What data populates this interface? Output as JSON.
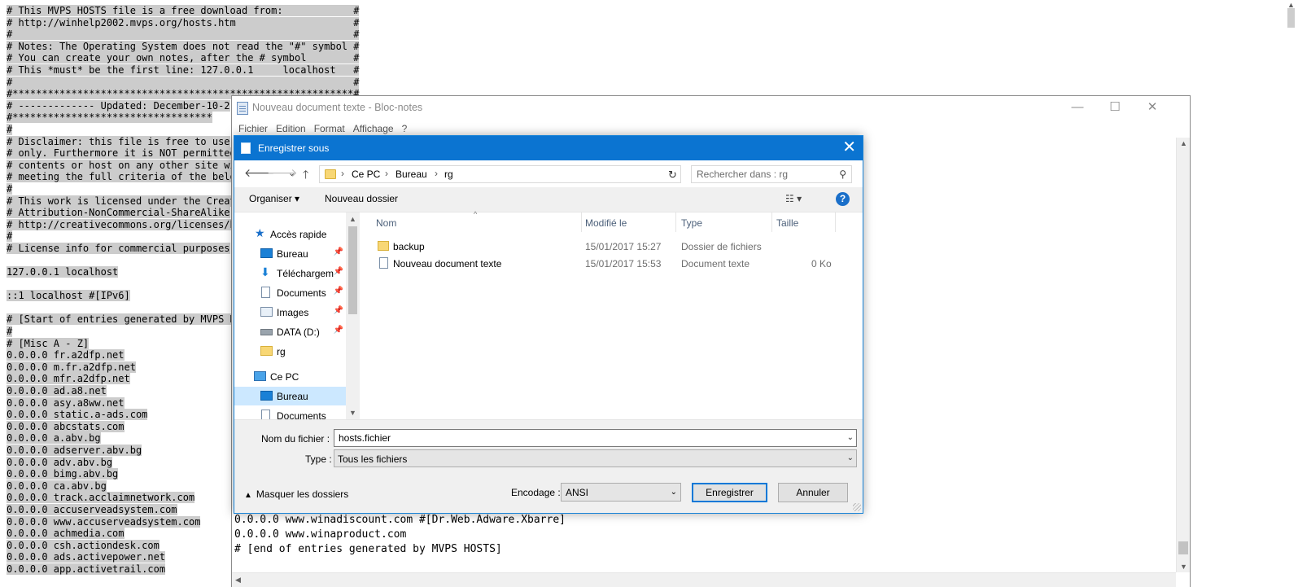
{
  "background_text": {
    "lines": [
      "# This MVPS HOSTS file is a free download from:            #",
      "# http://winhelp2002.mvps.org/hosts.htm                    #",
      "#                                                          #",
      "# Notes: The Operating System does not read the \"#\" symbol #",
      "# You can create your own notes, after the # symbol        #",
      "# This *must* be the first line: 127.0.0.1     localhost   #",
      "#                                                          #",
      "#**********************************************************#",
      "# ------------- Updated: December-10-2",
      "#**********************************",
      "#",
      "# Disclaimer: this file is free to use",
      "# only. Furthermore it is NOT permitted",
      "# contents or host on any other site wi",
      "# meeting the full criteria of the belo",
      "#",
      "# This work is licensed under the Creat",
      "# Attribution-NonCommercial-ShareAlike",
      "# http://creativecommons.org/licenses/b",
      "#",
      "# License info for commercial purposes",
      "",
      "127.0.0.1 localhost",
      "",
      "::1 localhost #[IPv6]",
      "",
      "# [Start of entries generated by MVPS H",
      "#",
      "# [Misc A - Z]",
      "0.0.0.0 fr.a2dfp.net",
      "0.0.0.0 m.fr.a2dfp.net",
      "0.0.0.0 mfr.a2dfp.net",
      "0.0.0.0 ad.a8.net",
      "0.0.0.0 asy.a8ww.net",
      "0.0.0.0 static.a-ads.com",
      "0.0.0.0 abcstats.com",
      "0.0.0.0 a.abv.bg",
      "0.0.0.0 adserver.abv.bg",
      "0.0.0.0 adv.abv.bg",
      "0.0.0.0 bimg.abv.bg",
      "0.0.0.0 ca.abv.bg",
      "0.0.0.0 track.acclaimnetwork.com",
      "0.0.0.0 accuserveadsystem.com",
      "0.0.0.0 www.accuserveadsystem.com",
      "0.0.0.0 achmedia.com",
      "0.0.0.0 csh.actiondesk.com",
      "0.0.0.0 ads.activepower.net",
      "0.0.0.0 app.activetrail.com"
    ]
  },
  "notepad": {
    "title": "Nouveau document texte - Bloc-notes",
    "controls": {
      "minimize": "—",
      "maximize": "☐",
      "close": "✕"
    },
    "menu": [
      "Fichier",
      "Edition",
      "Format",
      "Affichage",
      "?"
    ],
    "visible_lines": [
      "0.0.0.0 www.winadiscount.com #[Dr.Web.Adware.Xbarre]",
      "0.0.0.0 www.winaproduct.com",
      "# [end of entries generated by MVPS HOSTS]"
    ]
  },
  "dialog": {
    "title": "Enregistrer sous",
    "close": "✕",
    "nav": {
      "back": "🡐",
      "forward": "🡒",
      "recent": "⌄",
      "up": "🡑"
    },
    "path": [
      "Ce PC",
      "Bureau",
      "rg"
    ],
    "refresh": "↻",
    "search_placeholder": "Rechercher dans : rg",
    "search_icon": "search-icon",
    "toolbar": {
      "organize": "Organiser ▾",
      "new_folder": "Nouveau dossier",
      "view": "☷ ▾",
      "help": "?"
    },
    "navpane": [
      {
        "label": "Accès rapide",
        "icon": "star-icon",
        "pinned": false
      },
      {
        "label": "Bureau",
        "icon": "desktop-icon",
        "pinned": true
      },
      {
        "label": "Téléchargements",
        "icon": "download-icon",
        "pinned": true
      },
      {
        "label": "Documents",
        "icon": "document-icon",
        "pinned": true
      },
      {
        "label": "Images",
        "icon": "image-icon",
        "pinned": true
      },
      {
        "label": "DATA (D:)",
        "icon": "drive-icon",
        "pinned": true
      },
      {
        "label": "rg",
        "icon": "folder-icon",
        "pinned": false
      },
      {
        "label": "Ce PC",
        "icon": "computer-icon",
        "pinned": false
      },
      {
        "label": "Bureau",
        "icon": "desktop-icon",
        "pinned": false,
        "selected": true
      },
      {
        "label": "Documents",
        "icon": "document-icon",
        "pinned": false
      }
    ],
    "columns": [
      "Nom",
      "Modifié le",
      "Type",
      "Taille"
    ],
    "files": [
      {
        "name": "backup",
        "modified": "15/01/2017 15:27",
        "type": "Dossier de fichiers",
        "size": "",
        "icon": "folder-icon"
      },
      {
        "name": "Nouveau document texte",
        "modified": "15/01/2017 15:53",
        "type": "Document texte",
        "size": "0 Ko",
        "icon": "text-file-icon"
      }
    ],
    "filename_label": "Nom du fichier :",
    "filename_value": "hosts.fichier",
    "type_label": "Type :",
    "type_value": "Tous les fichiers",
    "hide_folders": "Masquer les dossiers",
    "encoding_label": "Encodage :",
    "encoding_value": "ANSI",
    "save": "Enregistrer",
    "cancel": "Annuler"
  }
}
